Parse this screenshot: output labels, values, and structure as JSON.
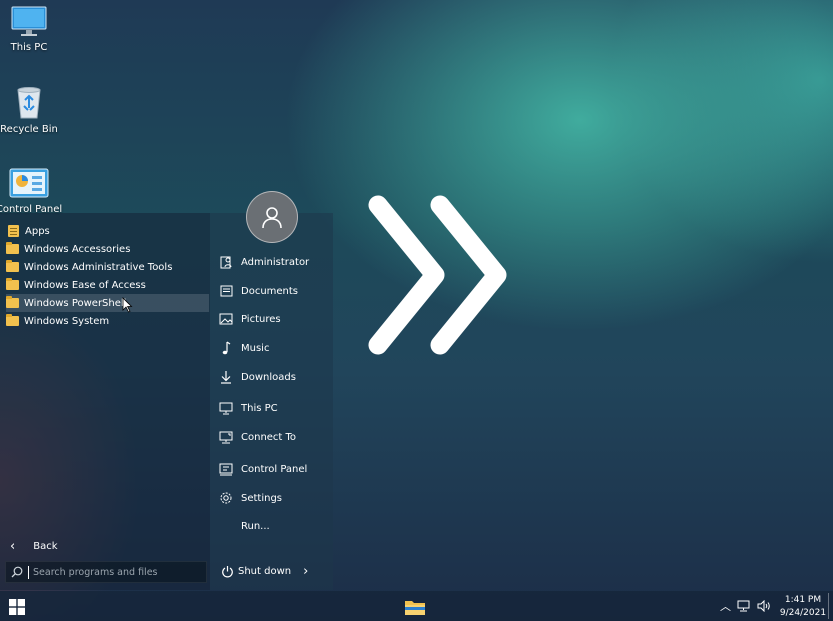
{
  "desktop": {
    "icons": [
      {
        "label": "This PC",
        "icon": "monitor-icon"
      },
      {
        "label": "Recycle Bin",
        "icon": "recycle-bin-icon"
      },
      {
        "label": "Control Panel",
        "icon": "control-panel-icon"
      }
    ]
  },
  "start_menu": {
    "programs": [
      {
        "label": "Apps",
        "icon": "apps-icon"
      },
      {
        "label": "Windows Accessories",
        "icon": "folder-icon"
      },
      {
        "label": "Windows Administrative Tools",
        "icon": "folder-icon"
      },
      {
        "label": "Windows Ease of Access",
        "icon": "folder-icon"
      },
      {
        "label": "Windows PowerShell",
        "icon": "folder-icon",
        "highlighted": true
      },
      {
        "label": "Windows System",
        "icon": "folder-icon"
      }
    ],
    "back_label": "Back",
    "search_placeholder": "Search programs and files",
    "places": [
      {
        "label": "Administrator",
        "icon": "user-folder-icon"
      },
      {
        "label": "Documents",
        "icon": "document-icon"
      },
      {
        "label": "Pictures",
        "icon": "picture-icon"
      },
      {
        "label": "Music",
        "icon": "music-icon"
      },
      {
        "label": "Downloads",
        "icon": "download-icon"
      },
      {
        "label": "This PC",
        "icon": "computer-icon"
      },
      {
        "label": "Connect To",
        "icon": "connect-icon"
      },
      {
        "label": "Control Panel",
        "icon": "control-panel-icon"
      },
      {
        "label": "Settings",
        "icon": "gear-icon"
      },
      {
        "label": "Run...",
        "icon": "run-icon"
      }
    ],
    "shutdown_label": "Shut down"
  },
  "taskbar": {
    "time": "1:41 PM",
    "date": "9/24/2021"
  },
  "colors": {
    "folder": "#f2c14e",
    "accent": "#3fb5a8"
  }
}
